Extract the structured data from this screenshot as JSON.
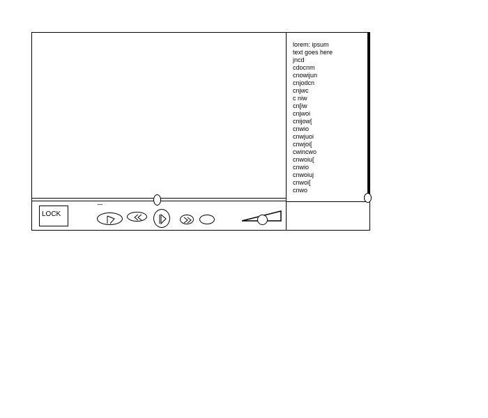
{
  "player": {
    "lock_label": "LOCK",
    "info_lines": [
      "lorem: ipsum",
      "text goes here",
      "jncd",
      "cdocnm",
      "cnowijun",
      "cnjodcn",
      "cnjwc",
      "c niw",
      "cn[iw",
      "cnjwoi",
      "cnijow[",
      "cnwio",
      "cnwjuoi",
      "cnwjoi[",
      "cwincwo",
      "cnwoiu[",
      "cnwio",
      "cnwoiuj",
      "cnwoi[",
      "cnwo"
    ]
  },
  "icons": {
    "skip_back": "skip-back-icon",
    "rewind": "rewind-icon",
    "play": "play-icon",
    "forward": "fast-forward-icon"
  }
}
